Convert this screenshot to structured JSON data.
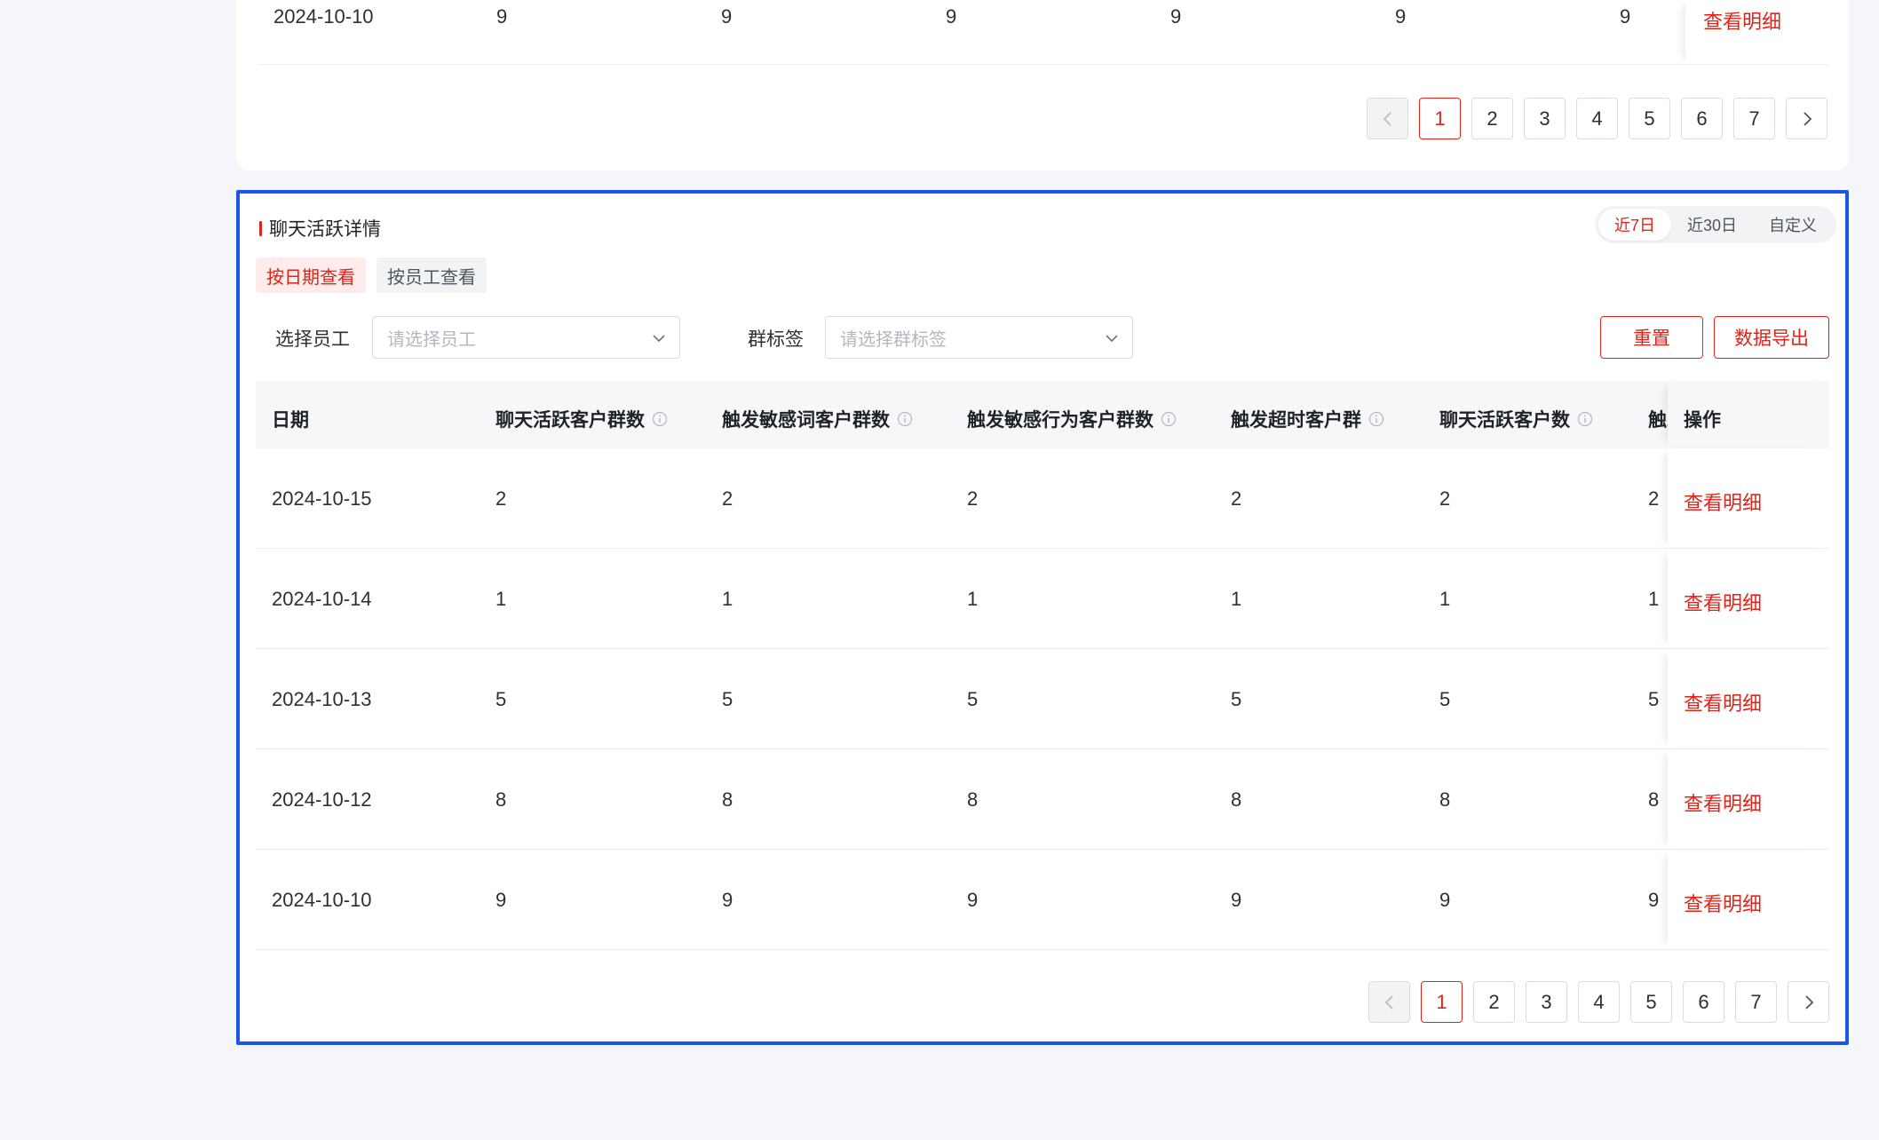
{
  "top_card": {
    "last_row": {
      "date": "2024-10-10",
      "values": [
        "9",
        "9",
        "9",
        "9",
        "9",
        "9"
      ],
      "action": "查看明细"
    },
    "pagination": {
      "pages": [
        "1",
        "2",
        "3",
        "4",
        "5",
        "6",
        "7"
      ],
      "current": "1"
    }
  },
  "main": {
    "title": "聊天活跃详情",
    "ranges": [
      "近7日",
      "近30日",
      "自定义"
    ],
    "active_range": "近7日",
    "view_tabs": [
      "按日期查看",
      "按员工查看"
    ],
    "active_view": "按日期查看",
    "filters": {
      "employee_label": "选择员工",
      "employee_placeholder": "请选择员工",
      "tag_label": "群标签",
      "tag_placeholder": "请选择群标签"
    },
    "buttons": {
      "reset": "重置",
      "export": "数据导出"
    },
    "table": {
      "columns": [
        "日期",
        "聊天活跃客户群数",
        "触发敏感词客户群数",
        "触发敏感行为客户群数",
        "触发超时客户群",
        "聊天活跃客户数",
        "触发",
        "操作"
      ],
      "rows": [
        {
          "date": "2024-10-15",
          "values": [
            "2",
            "2",
            "2",
            "2",
            "2",
            "2"
          ],
          "action": "查看明细"
        },
        {
          "date": "2024-10-14",
          "values": [
            "1",
            "1",
            "1",
            "1",
            "1",
            "1"
          ],
          "action": "查看明细"
        },
        {
          "date": "2024-10-13",
          "values": [
            "5",
            "5",
            "5",
            "5",
            "5",
            "5"
          ],
          "action": "查看明细"
        },
        {
          "date": "2024-10-12",
          "values": [
            "8",
            "8",
            "8",
            "8",
            "8",
            "8"
          ],
          "action": "查看明细"
        },
        {
          "date": "2024-10-10",
          "values": [
            "9",
            "9",
            "9",
            "9",
            "9",
            "9"
          ],
          "action": "查看明细"
        }
      ]
    },
    "pagination": {
      "pages": [
        "1",
        "2",
        "3",
        "4",
        "5",
        "6",
        "7"
      ],
      "current": "1"
    },
    "colors": {
      "accent": "#e2231a",
      "selection_border": "#1a56e8"
    }
  }
}
